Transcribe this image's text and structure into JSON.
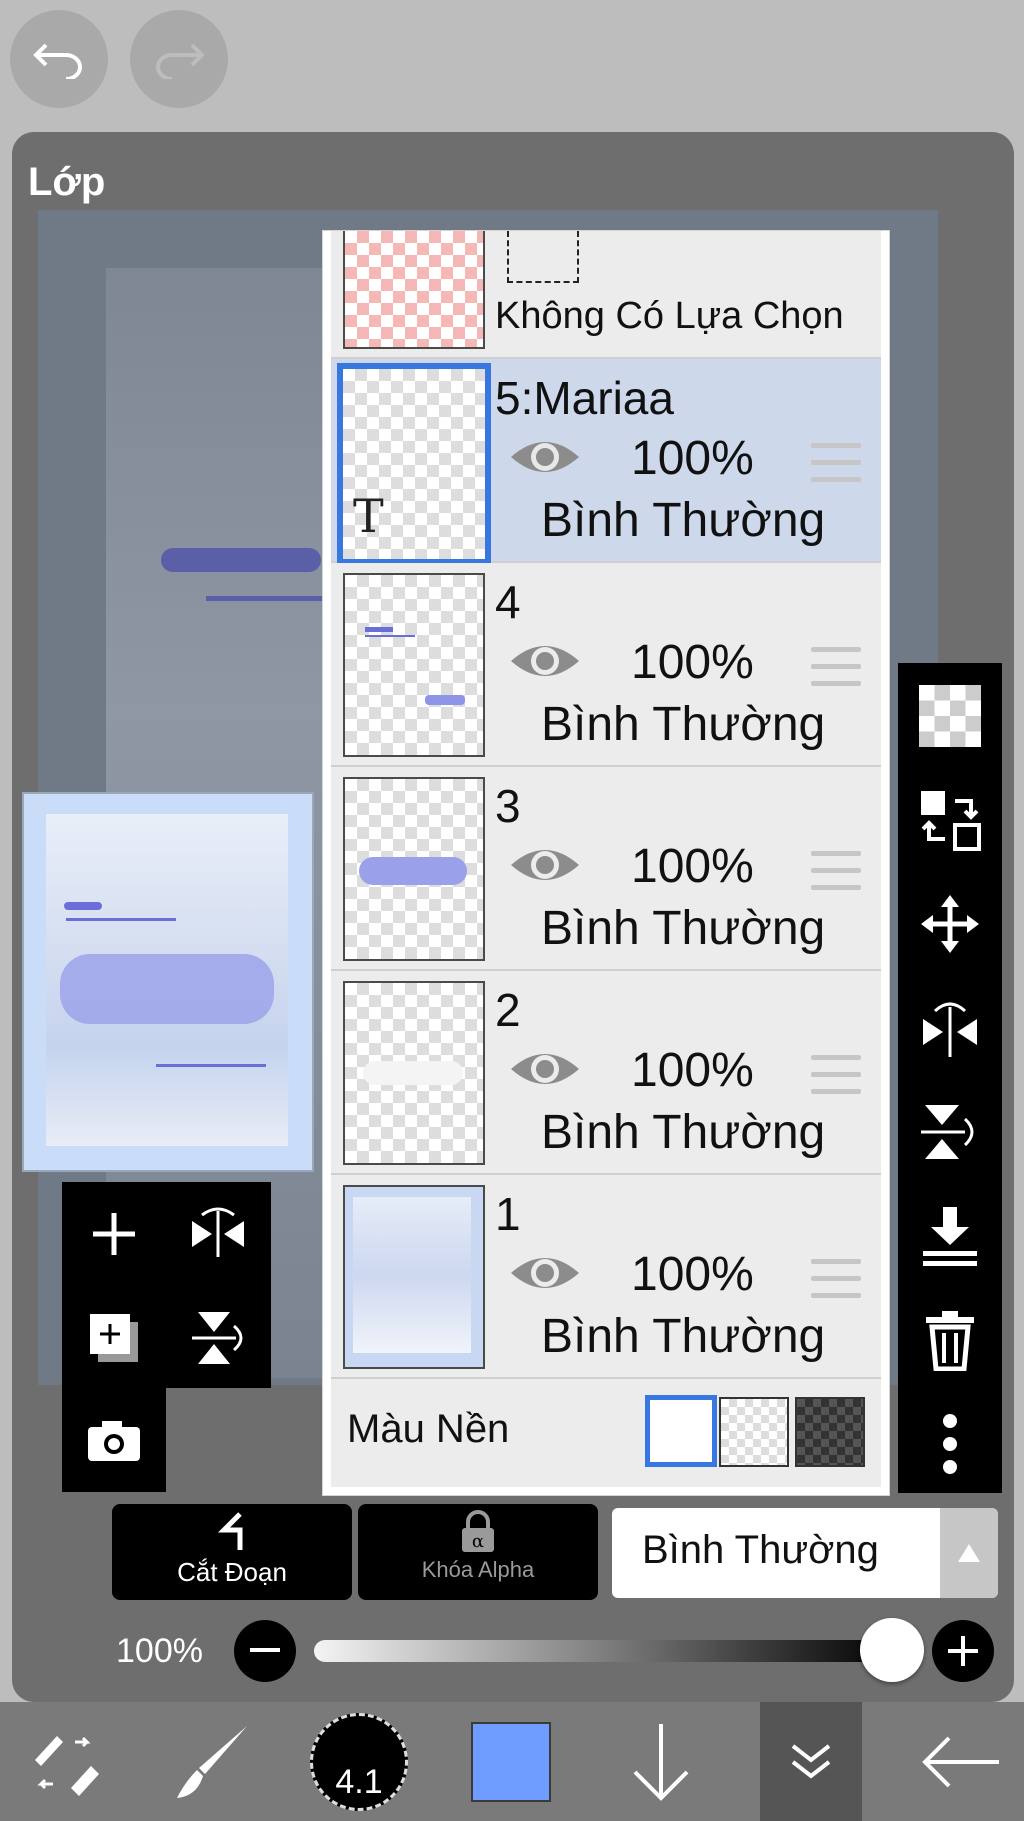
{
  "panel": {
    "title": "Lớp"
  },
  "selection_row": {
    "label": "Không Có Lựa Chọn"
  },
  "layers": [
    {
      "name": "5:Mariaa",
      "opacity": "100%",
      "blend": "Bình Thường",
      "selected": true,
      "thumb_icon": "text-layer-icon",
      "thumb_text": "T"
    },
    {
      "name": "4",
      "opacity": "100%",
      "blend": "Bình Thường",
      "selected": false
    },
    {
      "name": "3",
      "opacity": "100%",
      "blend": "Bình Thường",
      "selected": false
    },
    {
      "name": "2",
      "opacity": "100%",
      "blend": "Bình Thường",
      "selected": false
    },
    {
      "name": "1",
      "opacity": "100%",
      "blend": "Bình Thường",
      "selected": false
    }
  ],
  "background": {
    "label": "Màu Nền",
    "options": [
      "white",
      "transparent",
      "dark"
    ],
    "selected": "white"
  },
  "actions": {
    "clip_label": "Cắt Đoạn",
    "alpha_lock_label": "Khóa Alpha",
    "blend_mode": "Bình Thường"
  },
  "opacity_slider": {
    "label": "100%",
    "value": 1.0
  },
  "toolbar": {
    "brush_size": "4.1",
    "color": "#6f9cff"
  },
  "colors": {
    "accent": "#3877e0",
    "selected_row": "#cdd8ea"
  }
}
